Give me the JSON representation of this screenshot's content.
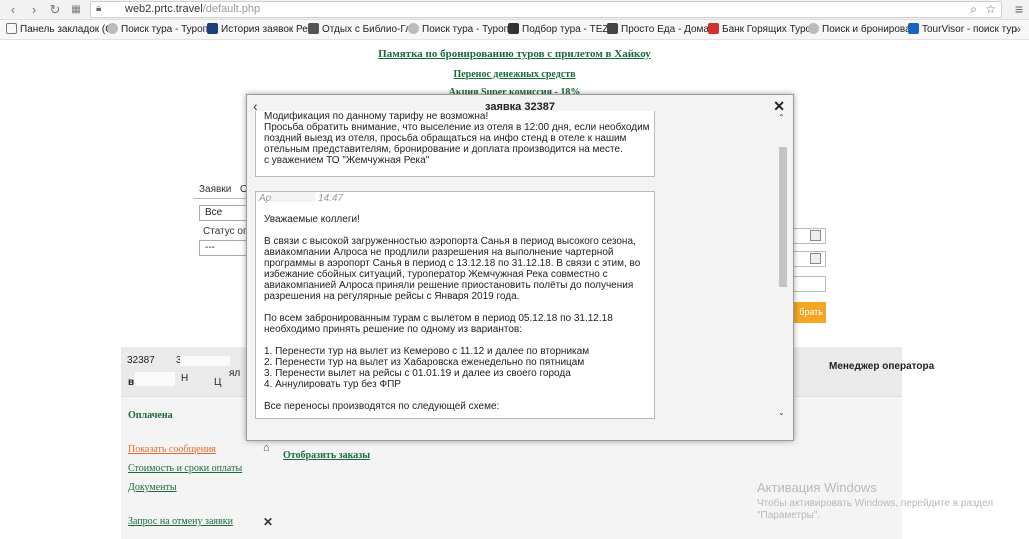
{
  "browser": {
    "url_host": "web2.prtc.travel",
    "url_path": "/default.php",
    "bookmarks": [
      "Панель закладок (С",
      "Поиск тура - Туропе",
      "История заявок Рег",
      "Отдых с Библио-Гло",
      "Поиск тура - Туропе",
      "Подбор тура - TEZ T",
      "Просто Еда - Домаш",
      "Банк Горящих Туров",
      "Поиск и бронироват",
      "TourVisor - поиск тур"
    ]
  },
  "page": {
    "link_memo": "Памятка по бронированию туров с прилетом в Хайкоу",
    "link_transfer": "Перенос денежных средств",
    "link_promo": "Акция Super комиссия - 18%",
    "tab_orders": "Заявки",
    "tab_other": "О",
    "select_all": "Все",
    "label_payment_status": "Статус опл",
    "select_dash": "---",
    "orange_button": "брать",
    "order_id_partial": "32387",
    "order_number_partial": "31",
    "row_letter": "в",
    "col_letter": "Н",
    "col_short": "Ц",
    "col_am": "ял",
    "status_paid": "Оплачена",
    "link_show_messages": "Показать сообщения",
    "link_cost_terms": "Стоимость и сроки оплаты",
    "link_documents": "Документы",
    "link_cancel_request": "Запрос на отмену заявки",
    "link_show_orders": "Отобразить заказы",
    "manager_header": "Менеджер оператора"
  },
  "modal": {
    "title": "заявка 32387",
    "message1": "Модификация по данному тарифу не возможна!\nПросьба обратить внимание, что выселение из отеля в 12:00 дня, если необходим поздний выезд из отеля, просьба обращаться на инфо стенд в отеле к нашим отельным представителям, бронирование и доплата производится на месте.\nс уважением ТО \"Жемчужная Река\"",
    "message2_author": "Ар",
    "message2_time": "14:47",
    "message2": "Уважаемые коллеги!\n\nВ связи с высокой загруженностью аэропорта Санья в период высокого сезона, авиакомпании Алроса не продлили разрешения на выполнение чартерной программы в аэропорт Санья в период с 13.12.18 по 31.12.18. В связи с этим, во избежание сбойных ситуаций, туроператор Жемчужная Река совместно с авиакомпанией Алроса приняли решение приостановить полёты до получения разрешения на регулярные рейсы с Января 2019 года.\n\nПо всем забронированным турам с вылетом в период 05.12.18 по 31.12.18 необходимо принять решение по одному из вариантов:\n\n1. Перенести тур на вылет из Кемерово с 11.12 и далее по вторникам\n2. Перенести тур на вылет из Хабаровска еженедельно по пятницам\n3. Перенести вылет на рейсы с 01.01.19 и далее из своего города\n4. Аннулировать тур без ФПР\n\nВсе переносы производятся по следующей схеме:"
  },
  "windows": {
    "activation_title": "Активация Windows",
    "activation_text": "Чтобы активировать Windows, перейдите в раздел \"Параметры\"."
  }
}
